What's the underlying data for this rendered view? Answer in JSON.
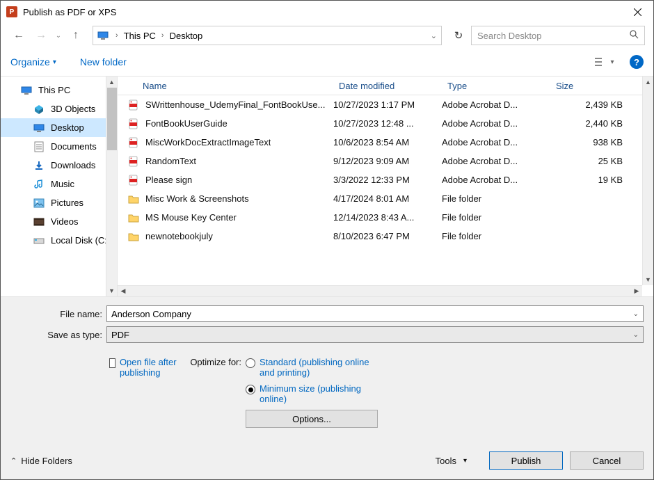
{
  "window": {
    "title": "Publish as PDF or XPS"
  },
  "breadcrumb": {
    "root": "This PC",
    "leaf": "Desktop"
  },
  "search": {
    "placeholder": "Search Desktop"
  },
  "toolbar": {
    "organize": "Organize",
    "new_folder": "New folder"
  },
  "sidebar": {
    "items": [
      {
        "label": "This PC"
      },
      {
        "label": "3D Objects"
      },
      {
        "label": "Desktop"
      },
      {
        "label": "Documents"
      },
      {
        "label": "Downloads"
      },
      {
        "label": "Music"
      },
      {
        "label": "Pictures"
      },
      {
        "label": "Videos"
      },
      {
        "label": "Local Disk (C:)"
      }
    ]
  },
  "columns": {
    "name": "Name",
    "date": "Date modified",
    "type": "Type",
    "size": "Size"
  },
  "files": [
    {
      "name": "SWrittenhouse_UdemyFinal_FontBookUse...",
      "date": "10/27/2023 1:17 PM",
      "type": "Adobe Acrobat D...",
      "size": "2,439 KB",
      "kind": "pdf"
    },
    {
      "name": "FontBookUserGuide",
      "date": "10/27/2023 12:48 ...",
      "type": "Adobe Acrobat D...",
      "size": "2,440 KB",
      "kind": "pdf"
    },
    {
      "name": "MiscWorkDocExtractImageText",
      "date": "10/6/2023 8:54 AM",
      "type": "Adobe Acrobat D...",
      "size": "938 KB",
      "kind": "pdf"
    },
    {
      "name": "RandomText",
      "date": "9/12/2023 9:09 AM",
      "type": "Adobe Acrobat D...",
      "size": "25 KB",
      "kind": "pdf"
    },
    {
      "name": "Please sign",
      "date": "3/3/2022 12:33 PM",
      "type": "Adobe Acrobat D...",
      "size": "19 KB",
      "kind": "pdf"
    },
    {
      "name": "Misc Work & Screenshots",
      "date": "4/17/2024 8:01 AM",
      "type": "File folder",
      "size": "",
      "kind": "folder"
    },
    {
      "name": "MS Mouse Key Center",
      "date": "12/14/2023 8:43 A...",
      "type": "File folder",
      "size": "",
      "kind": "folder"
    },
    {
      "name": "newnotebookjuly",
      "date": "8/10/2023 6:47 PM",
      "type": "File folder",
      "size": "",
      "kind": "folder"
    }
  ],
  "form": {
    "filename_label": "File name:",
    "filename_value": "Anderson Company",
    "savetype_label": "Save as type:",
    "savetype_value": "PDF"
  },
  "options": {
    "open_after_label": "Open file after publishing",
    "optimize_label": "Optimize for:",
    "standard_label": "Standard (publishing online and printing)",
    "minimum_label": "Minimum size (publishing online)",
    "options_button": "Options..."
  },
  "footer": {
    "hide_folders": "Hide Folders",
    "tools": "Tools",
    "publish": "Publish",
    "cancel": "Cancel"
  }
}
